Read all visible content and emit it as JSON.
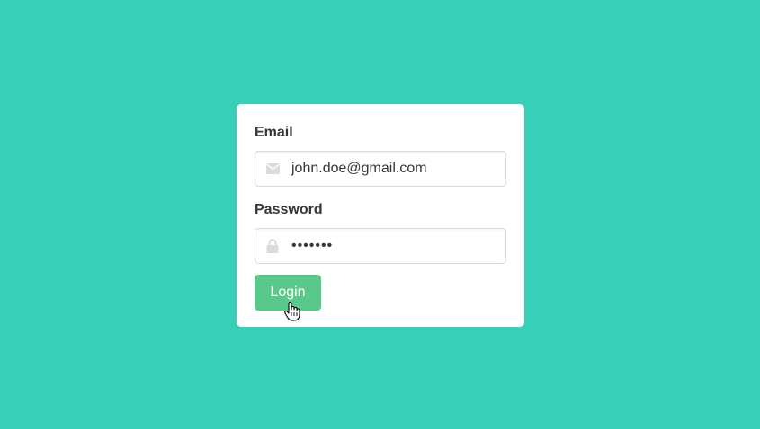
{
  "form": {
    "email": {
      "label": "Email",
      "value": "john.doe@gmail.com",
      "icon": "envelope-icon"
    },
    "password": {
      "label": "Password",
      "value": "•••••••",
      "icon": "lock-icon"
    },
    "login_button": {
      "label": "Login"
    }
  },
  "colors": {
    "background": "#37d0b6",
    "card": "#ffffff",
    "button": "#58c98a",
    "label_text": "#363636",
    "icon": "#dbdbdb"
  }
}
